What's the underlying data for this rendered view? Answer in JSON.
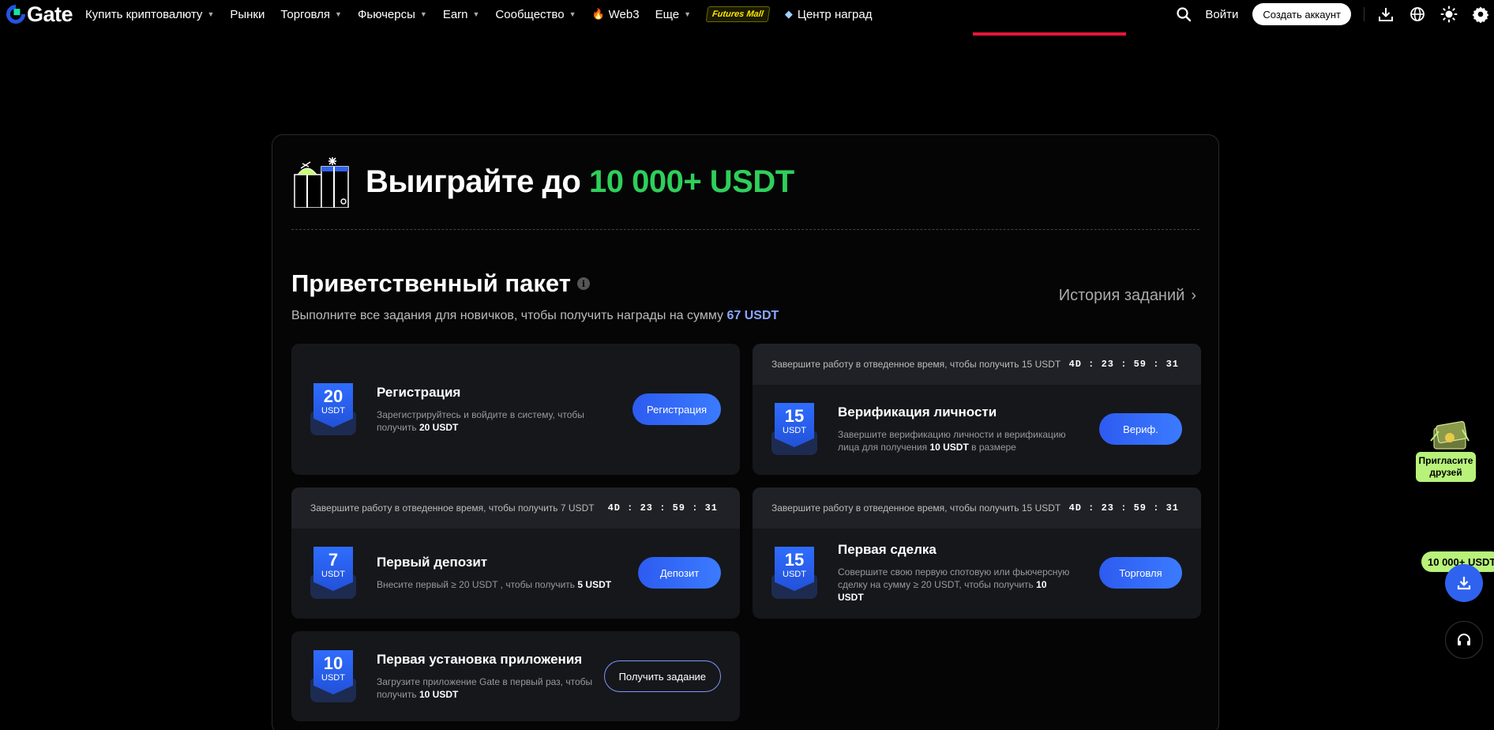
{
  "nav": {
    "logo_text": "Gate",
    "items": [
      {
        "label": "Купить криптовалюту",
        "caret": true
      },
      {
        "label": "Рынки",
        "caret": false
      },
      {
        "label": "Торговля",
        "caret": true
      },
      {
        "label": "Фьючерсы",
        "caret": true
      },
      {
        "label": "Earn",
        "caret": true
      },
      {
        "label": "Сообщество",
        "caret": true
      },
      {
        "label": "Web3",
        "caret": false
      },
      {
        "label": "Еще",
        "caret": true
      }
    ],
    "futures_mall": "Futures Mall",
    "rewards_center": "Центр наград",
    "login": "Войти",
    "signup": "Создать аккаунт"
  },
  "hero": {
    "title_prefix": "Выиграйте до",
    "title_amount": "10 000+ USDT"
  },
  "package": {
    "title": "Приветственный пакет",
    "subtitle_prefix": "Выполните все задания для новичков, чтобы получить награды на сумму",
    "subtitle_amount": "67 USDT",
    "history": "История заданий"
  },
  "tasks": [
    {
      "id": "registration",
      "header": null,
      "badge_num": "20",
      "badge_unit": "USDT",
      "name": "Регистрация",
      "desc": "Зарегистрируйтесь и войдите в систему, чтобы получить",
      "desc_bold": "20 USDT",
      "desc_suffix": "",
      "button": "Регистрация"
    },
    {
      "id": "kyc",
      "header": "Завершите работу в отведенное время, чтобы получить 15 USDT",
      "timer": "4D : 23 : 59 : 31",
      "badge_num": "15",
      "badge_unit": "USDT",
      "name": "Верификация личности",
      "desc": "Завершите верификацию личности и верификацию лица для получения",
      "desc_bold": "10 USDT",
      "desc_suffix": "в размере",
      "button": "Вериф."
    },
    {
      "id": "deposit",
      "header": "Завершите работу в отведенное время, чтобы получить 7 USDT",
      "timer": "4D : 23 : 59 : 31",
      "badge_num": "7",
      "badge_unit": "USDT",
      "name": "Первый депозит",
      "desc": "Внесите первый ≥ 20 USDT , чтобы получить",
      "desc_bold": "5 USDT",
      "desc_suffix": "",
      "button": "Депозит"
    },
    {
      "id": "trade",
      "header": "Завершите работу в отведенное время, чтобы получить 15 USDT",
      "timer": "4D : 23 : 59 : 31",
      "badge_num": "15",
      "badge_unit": "USDT",
      "name": "Первая сделка",
      "desc": "Совершите свою первую спотовую или фьючерсную сделку на сумму ≥ 20 USDT, чтобы получить",
      "desc_bold": "10 USDT",
      "desc_suffix": "",
      "button": "Торговля"
    },
    {
      "id": "app",
      "header": null,
      "badge_num": "10",
      "badge_unit": "USDT",
      "name": "Первая установка приложения",
      "desc": "Загрузите приложение Gate в первый раз, чтобы получить",
      "desc_bold": "10 USDT",
      "desc_suffix": "",
      "button": "Получить задание"
    }
  ],
  "side": {
    "invite": "Пригласите друзей",
    "promo": "10 000+ USDT"
  },
  "colors": {
    "accent": "#2f62ef",
    "green": "#2fcf5a",
    "highlight": "#e8163a",
    "lime": "#b8f27a"
  }
}
